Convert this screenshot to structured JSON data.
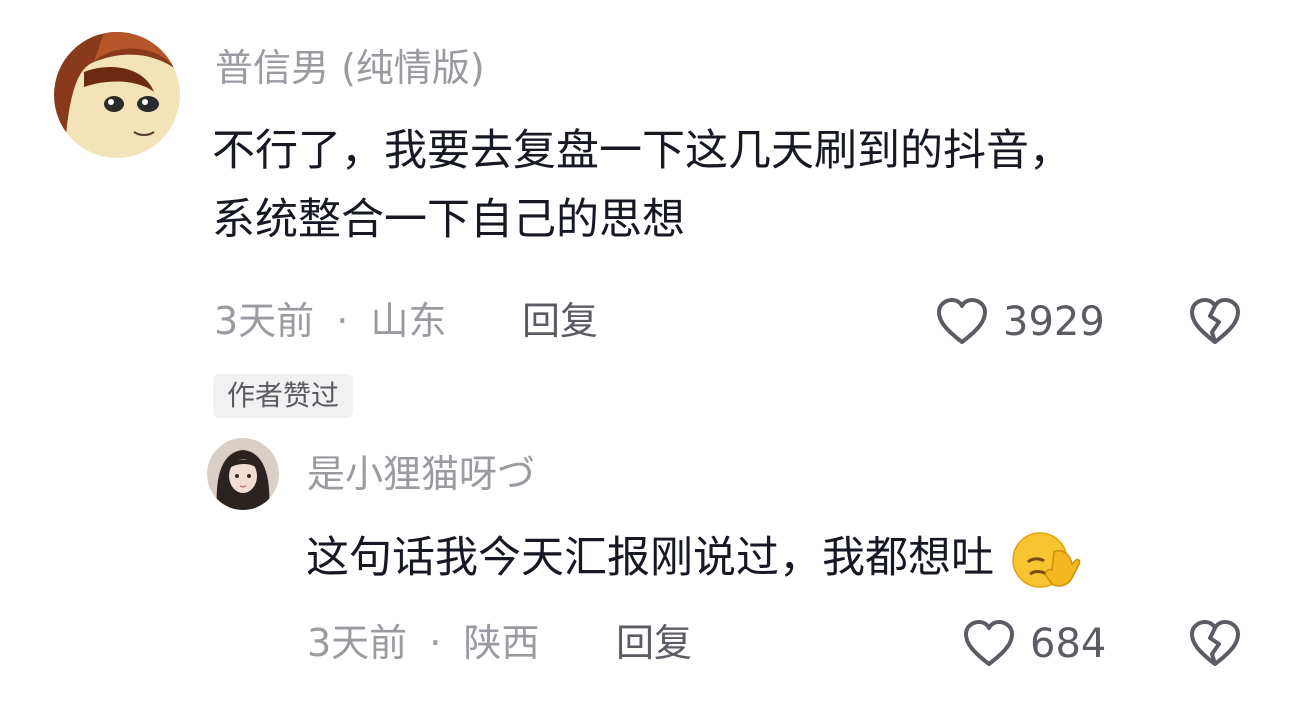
{
  "comment": {
    "username": "普信男 (纯情版)",
    "text_line1": "不行了，我要去复盘一下这几天刷到的抖音，",
    "text_line2": "系统整合一下自己的思想",
    "time": "3天前",
    "separator": "·",
    "location": "山东",
    "reply_label": "回复",
    "like_count": "3929",
    "badge": "作者赞过"
  },
  "reply": {
    "username": "是小狸猫呀づ",
    "text": "这句话我今天汇报刚说过，我都想吐",
    "emoji": "face-palm-emoji",
    "time": "3天前",
    "separator": "·",
    "location": "陕西",
    "reply_label": "回复",
    "like_count": "684"
  },
  "icons": {
    "like": "heart-outline-icon",
    "dislike": "broken-heart-icon"
  },
  "colors": {
    "text": "#161823",
    "secondary": "#9a9ba1",
    "action": "#5b5c63",
    "badge_bg": "#f1f1f2"
  }
}
